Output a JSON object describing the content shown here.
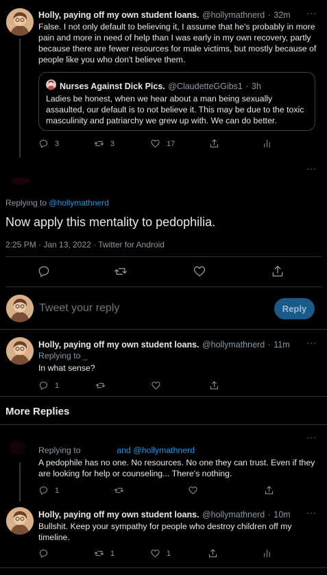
{
  "tweet1": {
    "name": "Holly, paying off my own student loans.",
    "handle": "@hollymathnerd",
    "sep": "·",
    "time": "32m",
    "text": "False. I not only default to believing it, I assume that he's probably in more pain and more in need of help than I was early in my own recovery, partly because there are fewer resources for male victims, but mostly because of people like you who don't believe them.",
    "quote": {
      "name": "Nurses Against Dick Pics.",
      "handle": "@ClaudetteGGibs1",
      "sep": "·",
      "time": "3h",
      "text": "Ladies be honest, when we hear about a man being sexually assaulted, our default is to not believe it. This may be due to the toxic masculinity and patriarchy we grew up with. We can do better."
    },
    "replies": "3",
    "retweets": "3",
    "likes": "17"
  },
  "main_tweet": {
    "replying_prefix": "Replying to",
    "replying_to": "@hollymathnerd",
    "text": "Now apply this mentality to pedophilia.",
    "meta": "2:25 PM · Jan 13, 2022 · Twitter for Android"
  },
  "compose": {
    "placeholder": "Tweet your reply",
    "button": "Reply"
  },
  "tweet3": {
    "name": "Holly, paying off my own student loans.",
    "handle": "@hollymathnerd",
    "sep": "·",
    "time": "11m",
    "replying_prefix": "Replying to",
    "replying_to": "_",
    "text": "In what sense?",
    "replies": "1"
  },
  "section_header": "More Replies",
  "tweet4": {
    "replying_prefix": "Replying to",
    "replying_to": "and @hollymathnerd",
    "text": "A pedophile has no one. No resources. No one they can trust. Even if they are looking for help or counseling... There's nothing.",
    "replies": "1"
  },
  "tweet5": {
    "name": "Holly, paying off my own student loans.",
    "handle": "@hollymathnerd",
    "sep": "·",
    "time": "10m",
    "text": "Bullshit. Keep your sympathy for people who destroy children off my timeline.",
    "retweets": "1",
    "likes": "1"
  },
  "more_glyph": "···",
  "colors": {
    "background": "#000000",
    "text": "#e7e9ea",
    "muted": "#8b98a5",
    "link": "#1d9bf0",
    "reply_button": "#1a5a8a"
  }
}
